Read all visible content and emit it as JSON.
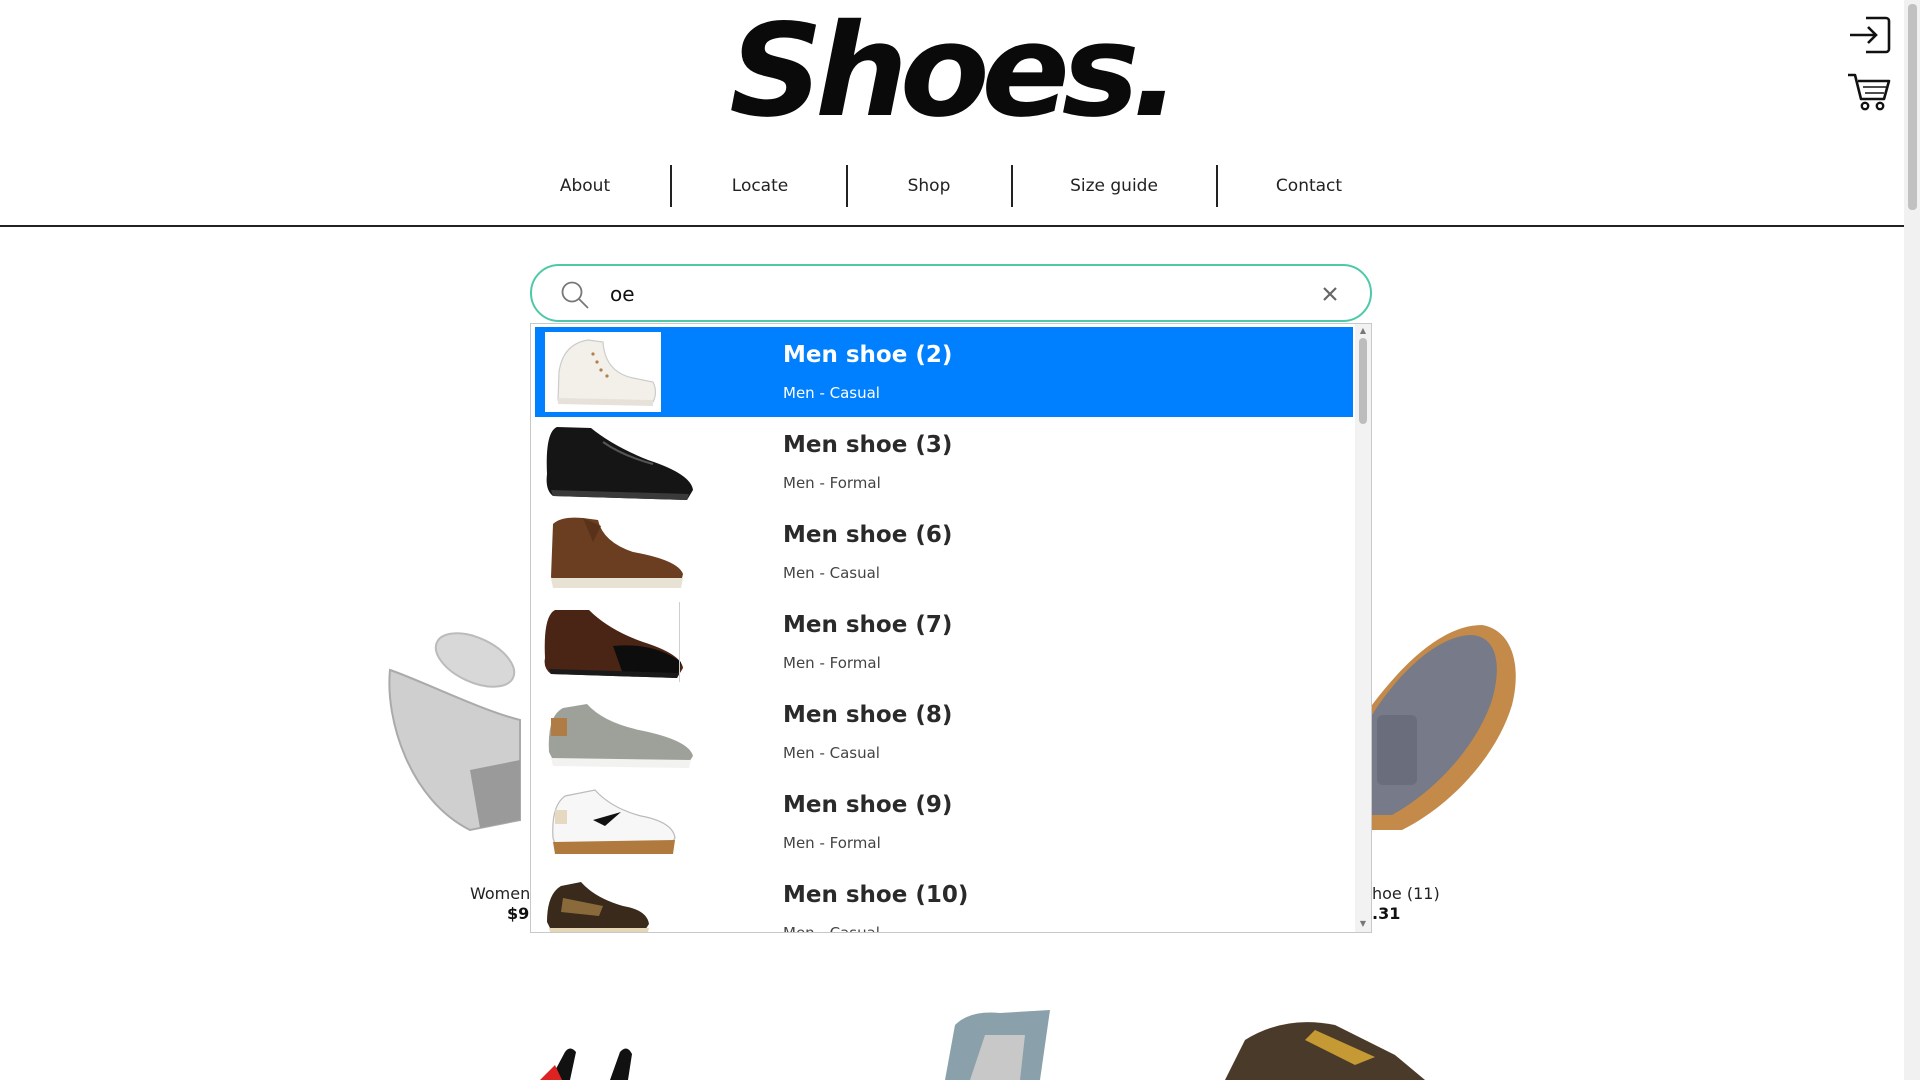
{
  "brand": {
    "logo_text": "Shoes."
  },
  "header_icons": [
    {
      "name": "login-icon"
    },
    {
      "name": "cart-icon"
    }
  ],
  "nav": {
    "items": [
      {
        "label": "About"
      },
      {
        "label": "Locate"
      },
      {
        "label": "Shop"
      },
      {
        "label": "Size guide"
      },
      {
        "label": "Contact"
      }
    ]
  },
  "search": {
    "value": "oe",
    "placeholder": "",
    "results": [
      {
        "title": "Men shoe (2)",
        "subtitle": "Men - Casual",
        "selected": true,
        "icon": "white-high-top-sneaker"
      },
      {
        "title": "Men shoe (3)",
        "subtitle": "Men - Formal",
        "selected": false,
        "icon": "black-dress-shoe"
      },
      {
        "title": "Men shoe (6)",
        "subtitle": "Men - Casual",
        "selected": false,
        "icon": "brown-chukka-boot"
      },
      {
        "title": "Men shoe (7)",
        "subtitle": "Men - Formal",
        "selected": false,
        "icon": "brown-oxford-shoe"
      },
      {
        "title": "Men shoe (8)",
        "subtitle": "Men - Casual",
        "selected": false,
        "icon": "grey-sneaker"
      },
      {
        "title": "Men shoe (9)",
        "subtitle": "Men - Formal",
        "selected": false,
        "icon": "white-gum-sneaker"
      },
      {
        "title": "Men shoe (10)",
        "subtitle": "Men - Casual",
        "selected": false,
        "icon": "brown-skate-shoe"
      }
    ]
  },
  "products": {
    "left": {
      "name": "Women",
      "price": "$9"
    },
    "right": {
      "name": "hoe (11)",
      "price": ".31"
    }
  },
  "colors": {
    "accent": "#4ec9a8",
    "selection": "#0080ff",
    "text": "#222222"
  }
}
